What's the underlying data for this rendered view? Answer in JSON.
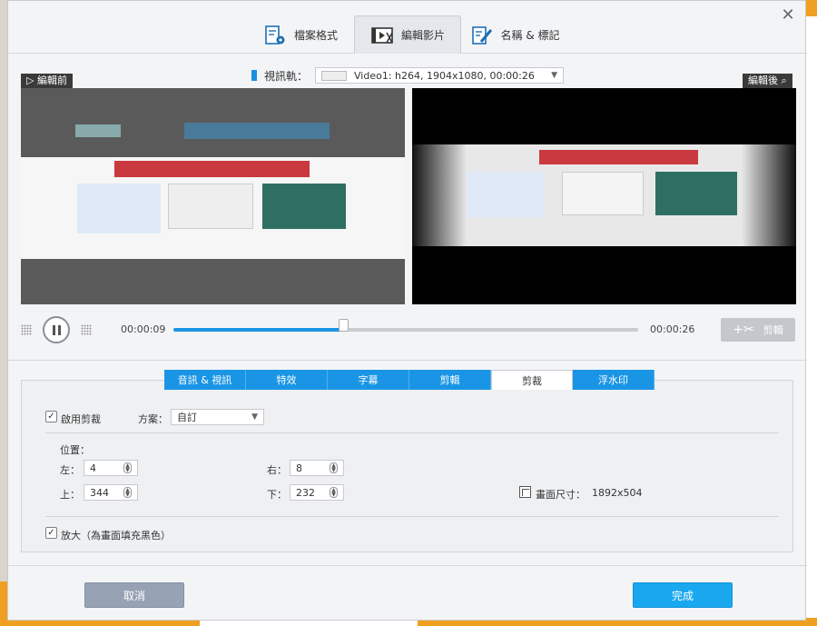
{
  "tabs": [
    {
      "label": "檔案格式",
      "icon": "document-settings-icon"
    },
    {
      "label": "編輯影片",
      "icon": "video-edit-icon"
    },
    {
      "label": "名稱 & 標記",
      "icon": "rename-tag-icon"
    }
  ],
  "track": {
    "label": "視訊軌：",
    "value": "Video1: h264, 1904x1080, 00:00:26"
  },
  "preview": {
    "before_label": "編輯前",
    "after_label": "編輯後"
  },
  "player": {
    "current_time": "00:00:09",
    "total_time": "00:00:26",
    "progress": 0.365,
    "cut_label": "剪輯"
  },
  "edit_tabs": [
    "音訊 & 視訊",
    "特效",
    "字幕",
    "剪輯",
    "剪裁",
    "浮水印"
  ],
  "crop": {
    "enable_label": "啟用剪裁",
    "scheme_label": "方案：",
    "scheme_value": "自訂",
    "position_label": "位置：",
    "left_label": "左：",
    "left_value": "4",
    "right_label": "右：",
    "right_value": "8",
    "top_label": "上：",
    "top_value": "344",
    "bottom_label": "下：",
    "bottom_value": "232",
    "size_label": "畫面尺寸：",
    "size_value": "1892x504",
    "zoom_label": "放大（為畫面填充黑色）"
  },
  "buttons": {
    "cancel": "取消",
    "done": "完成"
  },
  "colors": {
    "accent": "#1a95e6",
    "done_button": "#19a8f0",
    "cancel_button": "#97a3b4"
  }
}
